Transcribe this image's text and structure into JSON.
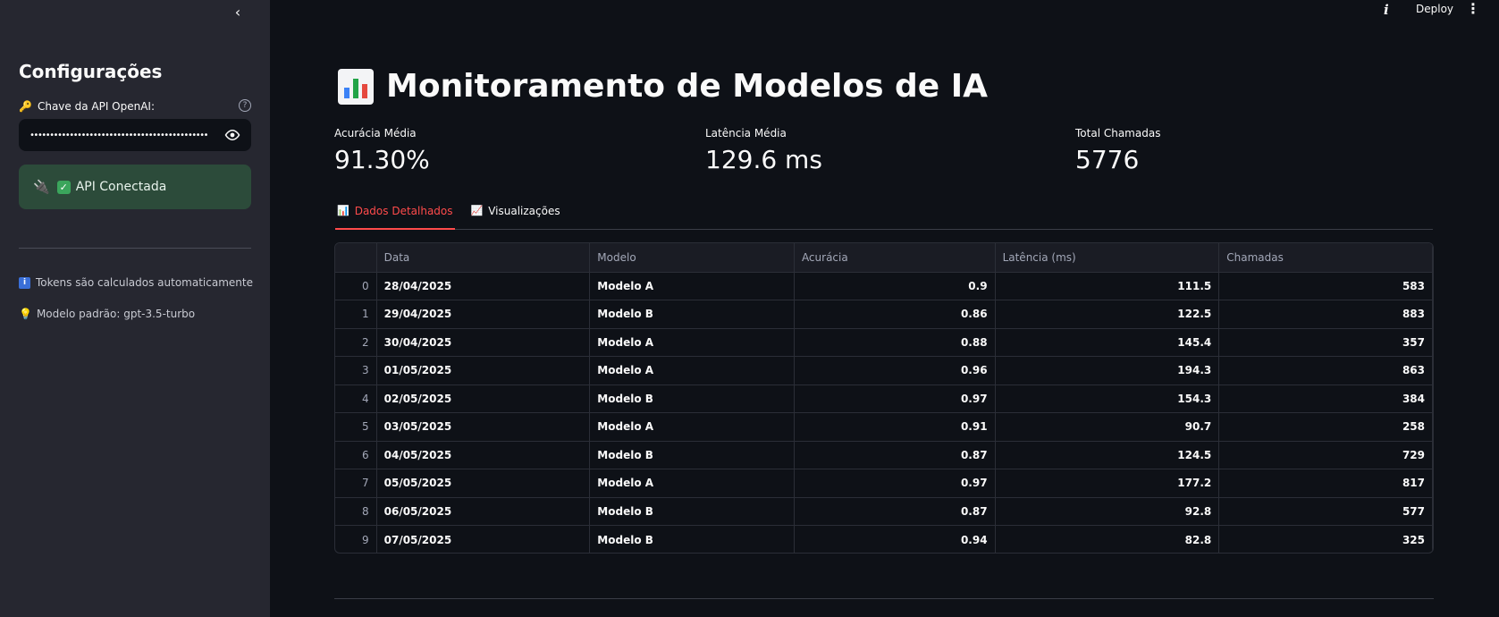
{
  "sidebar": {
    "collapse_glyph": "‹",
    "title": "Configurações",
    "api_key_label": "Chave da API OpenAI:",
    "api_key_value": "•••••••••••••••••••••••••••••••••••••••••••••••",
    "status_text": "API Conectada",
    "info_tokens": "Tokens são calculados automaticamente",
    "info_model": "Modelo padrão: gpt-3.5-turbo"
  },
  "topbar": {
    "info_glyph": "i",
    "deploy_label": "Deploy",
    "more_glyph": "⋮"
  },
  "main": {
    "title": "Monitoramento de Modelos de IA",
    "metrics": [
      {
        "label": "Acurácia Média",
        "value": "91.30%"
      },
      {
        "label": "Latência Média",
        "value": "129.6 ms"
      },
      {
        "label": "Total Chamadas",
        "value": "5776"
      }
    ],
    "tabs": [
      {
        "label": "Dados Detalhados",
        "icon": "bar-chart-icon"
      },
      {
        "label": "Visualizações",
        "icon": "trend-chart-icon"
      }
    ]
  },
  "table": {
    "columns": [
      "",
      "Data",
      "Modelo",
      "Acurácia",
      "Latência (ms)",
      "Chamadas"
    ],
    "rows": [
      [
        "0",
        "28/04/2025",
        "Modelo A",
        "0.9",
        "111.5",
        "583"
      ],
      [
        "1",
        "29/04/2025",
        "Modelo B",
        "0.86",
        "122.5",
        "883"
      ],
      [
        "2",
        "30/04/2025",
        "Modelo A",
        "0.88",
        "145.4",
        "357"
      ],
      [
        "3",
        "01/05/2025",
        "Modelo A",
        "0.96",
        "194.3",
        "863"
      ],
      [
        "4",
        "02/05/2025",
        "Modelo B",
        "0.97",
        "154.3",
        "384"
      ],
      [
        "5",
        "03/05/2025",
        "Modelo A",
        "0.91",
        "90.7",
        "258"
      ],
      [
        "6",
        "04/05/2025",
        "Modelo B",
        "0.87",
        "124.5",
        "729"
      ],
      [
        "7",
        "05/05/2025",
        "Modelo A",
        "0.97",
        "177.2",
        "817"
      ],
      [
        "8",
        "06/05/2025",
        "Modelo B",
        "0.87",
        "92.8",
        "577"
      ],
      [
        "9",
        "07/05/2025",
        "Modelo B",
        "0.94",
        "82.8",
        "325"
      ]
    ]
  },
  "colors": {
    "accent": "#ff4b4b",
    "sidebar_bg": "#262730",
    "main_bg": "#0e1117",
    "success_bg": "#2c4b3a"
  }
}
